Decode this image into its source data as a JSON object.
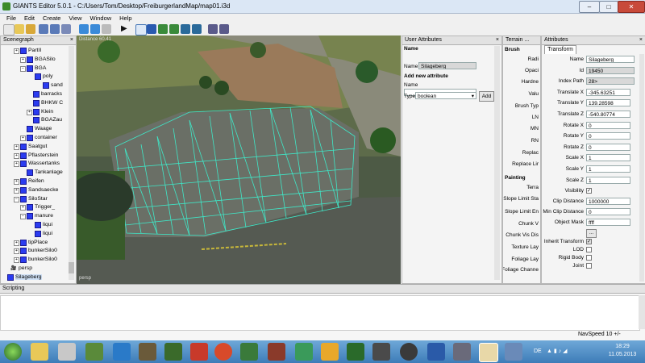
{
  "window": {
    "title": "GIANTS Editor 5.0.1 - C:/Users/Tom/Desktop/FreiburgerlandMap/map01.i3d",
    "minimize": "–",
    "maximize": "□",
    "close": "✕"
  },
  "menu": [
    "File",
    "Edit",
    "Create",
    "View",
    "Window",
    "Help"
  ],
  "scenegraph": {
    "title": "Scenegraph",
    "items": [
      "PartII",
      "BGASilo",
      "BGA",
      "poly",
      "sand",
      "barracks",
      "BHKW C",
      "Klein",
      "BGAZau",
      "Waage",
      "container",
      "Saatgut",
      "Pflasterstein",
      "Wassertanks",
      "Tankanlage",
      "Reifen",
      "Sandsaecke",
      "SiloStar",
      "Trigger_",
      "manure",
      "liqui",
      "liqui",
      "tipPlace",
      "bunkerSilo0",
      "bunkerSilo0",
      "persp",
      "Silageberg"
    ]
  },
  "viewport": {
    "distance": "Distance 60.41",
    "camera": "persp"
  },
  "user_attributes": {
    "title": "User Attributes",
    "section": "Name",
    "name_label": "Name",
    "name_value": "Silageberg",
    "add_label": "Add new attribute",
    "new_name_label": "Name",
    "type_label": "Type",
    "type_value": "boolean",
    "add_button": "Add"
  },
  "terrain": {
    "title": "Terrain ...",
    "brush_header": "Brush",
    "brush_items": [
      "Radi",
      "Opaci",
      "Hardne",
      "Valu",
      "Brush Typ",
      "LN",
      "MN",
      "RN",
      "Replac",
      "Replace Lir"
    ],
    "painting_header": "Painting",
    "painting_items": [
      "Terra",
      "Slope Limit Sta",
      "Slope Limit En",
      "Chunk V",
      "Chunk Vis Dis",
      "Texture Lay",
      "Foliage Lay",
      "Foliage Channe"
    ]
  },
  "attributes": {
    "title": "Attributes",
    "tab": "Transform",
    "fields": [
      {
        "label": "Name",
        "value": "Silageberg",
        "ro": false
      },
      {
        "label": "Id",
        "value": "19450",
        "ro": true
      },
      {
        "label": "Index Path",
        "value": "28>",
        "ro": true
      },
      {
        "label": "Translate X",
        "value": "-345.63251",
        "ro": false
      },
      {
        "label": "Translate Y",
        "value": "139.28598",
        "ro": false
      },
      {
        "label": "Translate Z",
        "value": "-540.80774",
        "ro": false
      },
      {
        "label": "Rotate X",
        "value": "0",
        "ro": false
      },
      {
        "label": "Rotate Y",
        "value": "0",
        "ro": false
      },
      {
        "label": "Rotate Z",
        "value": "0",
        "ro": false
      },
      {
        "label": "Scale X",
        "value": "1",
        "ro": false
      },
      {
        "label": "Scale Y",
        "value": "1",
        "ro": false
      },
      {
        "label": "Scale Z",
        "value": "1",
        "ro": false
      }
    ],
    "visibility_label": "Visibility",
    "clip_label": "Clip Distance",
    "clip_value": "1000000",
    "minclip_label": "Min Clip Distance",
    "minclip_value": "0",
    "mask_label": "Object Mask",
    "mask_value": "ffff",
    "more_button": "...",
    "checks": [
      "Inherit Transform",
      "LOD",
      "Rigid Body",
      "Joint"
    ]
  },
  "scripting": {
    "title": "Scripting"
  },
  "status": {
    "navspeed": "NavSpeed 10 +/-"
  },
  "taskbar": {
    "lang": "DE",
    "time": "18:29",
    "date": "11.05.2013"
  }
}
